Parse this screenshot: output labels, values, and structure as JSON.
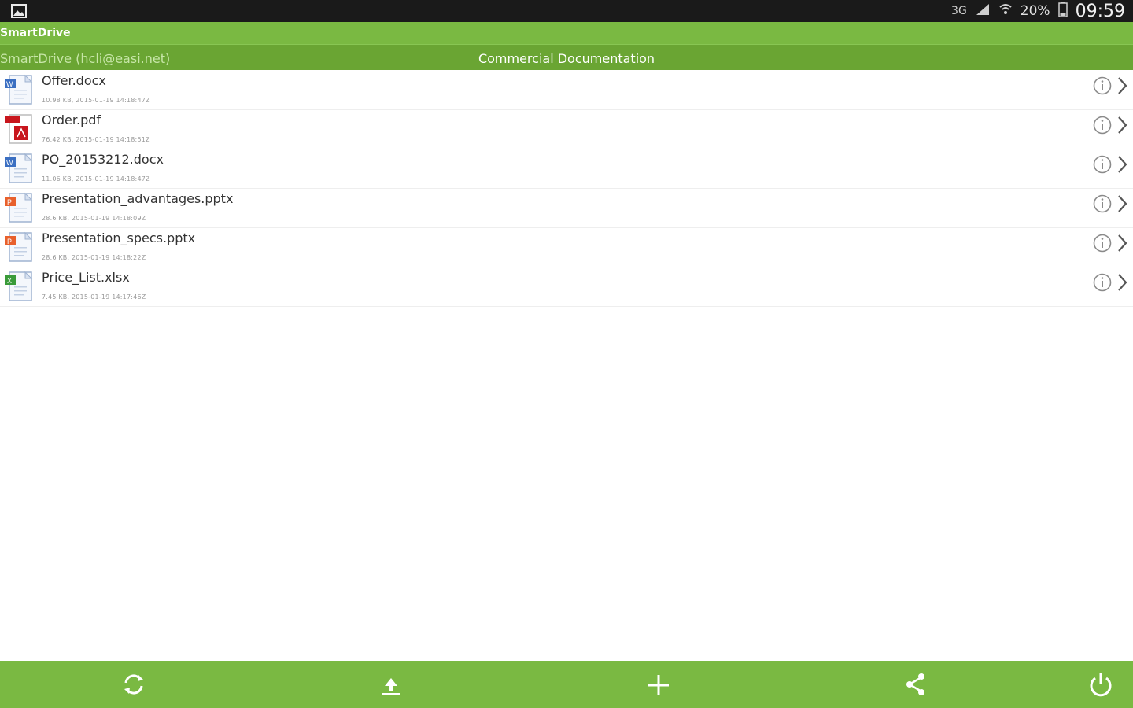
{
  "status_bar": {
    "network_label": "3G",
    "battery_percent": "20%",
    "time": "09:59"
  },
  "app": {
    "title": "SmartDrive"
  },
  "path_bar": {
    "account": "SmartDrive (hcli@easi.net)",
    "folder": "Commercial Documentation"
  },
  "files": [
    {
      "name": "Offer.docx",
      "meta": "10.98 KB, 2015-01-19 14:18:47Z",
      "type": "word",
      "icon": "docx-file-icon"
    },
    {
      "name": "Order.pdf",
      "meta": "76.42 KB, 2015-01-19 14:18:51Z",
      "type": "pdf",
      "icon": "pdf-file-icon"
    },
    {
      "name": "PO_20153212.docx",
      "meta": "11.06 KB, 2015-01-19 14:18:47Z",
      "type": "word",
      "icon": "docx-file-icon"
    },
    {
      "name": "Presentation_advantages.pptx",
      "meta": "28.6 KB, 2015-01-19 14:18:09Z",
      "type": "ppt",
      "icon": "pptx-file-icon"
    },
    {
      "name": "Presentation_specs.pptx",
      "meta": "28.6 KB, 2015-01-19 14:18:22Z",
      "type": "ppt",
      "icon": "pptx-file-icon"
    },
    {
      "name": "Price_List.xlsx",
      "meta": "7.45 KB, 2015-01-19 14:17:46Z",
      "type": "excel",
      "icon": "xlsx-file-icon"
    }
  ],
  "bottom_bar": {
    "actions": [
      "refresh-icon",
      "upload-icon",
      "add-icon",
      "share-icon",
      "power-icon"
    ]
  },
  "colors": {
    "app_green": "#7ab942",
    "path_green": "#6aa533",
    "status_black": "#1a1a1a",
    "word_blue": "#3b6fc2",
    "pdf_red": "#c8161d",
    "ppt_orange": "#e8602c",
    "excel_green": "#3a9b3a"
  }
}
